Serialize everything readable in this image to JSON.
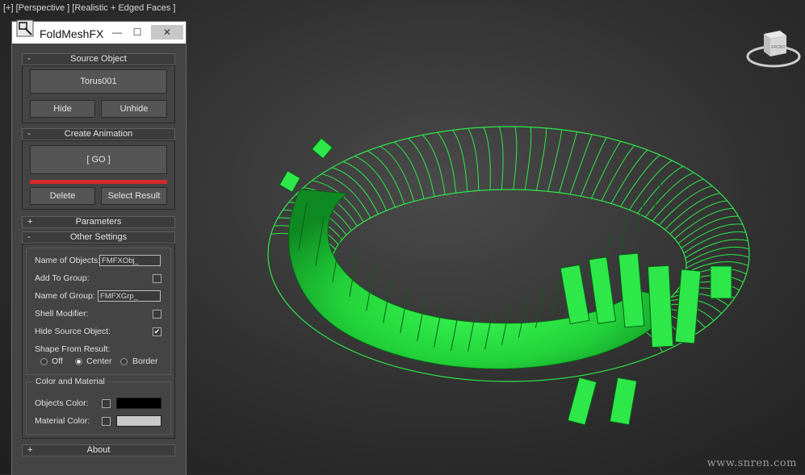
{
  "viewport": {
    "label": "[+] [Perspective ] [Realistic + Edged Faces ]",
    "viewcube_face": "FRONT",
    "watermark": "www.snren.com",
    "mesh_color": "#2ee84a"
  },
  "window": {
    "title": "FoldMeshFX",
    "app_icon": "search-window-icon",
    "minimize": "—",
    "maximize": "☐",
    "close": "✕"
  },
  "source_object": {
    "header": "Source Object",
    "collapse_sign": "-",
    "object_button": "Torus001",
    "hide_button": "Hide",
    "unhide_button": "Unhide"
  },
  "create_animation": {
    "header": "Create Animation",
    "collapse_sign": "-",
    "go_button": "[ GO ]",
    "progress": 1.0,
    "progress_color": "#d42a2a",
    "delete_button": "Delete",
    "select_result_button": "Select Result"
  },
  "parameters": {
    "header": "Parameters",
    "collapse_sign": "+"
  },
  "other_settings": {
    "header": "Other Settings",
    "collapse_sign": "-",
    "name_of_objects_label": "Name of Objects:",
    "name_of_objects_value": "FMFXObj_",
    "add_to_group_label": "Add To Group:",
    "add_to_group_checked": false,
    "name_of_group_label": "Name of Group:",
    "name_of_group_value": "FMFXGrp_",
    "shell_modifier_label": "Shell Modifier:",
    "shell_modifier_checked": false,
    "hide_source_label": "Hide Source Object:",
    "hide_source_checked": true,
    "shape_from_result_label": "Shape From Result:",
    "shape_options": [
      "Off",
      "Center",
      "Border"
    ],
    "shape_selected": "Center",
    "check_mark": "✔",
    "color_material": {
      "title": "Color and Material",
      "objects_color_label": "Objects Color:",
      "objects_color": "#000000",
      "material_color_label": "Material Color:",
      "material_color": "#c8c8c8"
    }
  },
  "about": {
    "header": "About",
    "collapse_sign": "+"
  }
}
